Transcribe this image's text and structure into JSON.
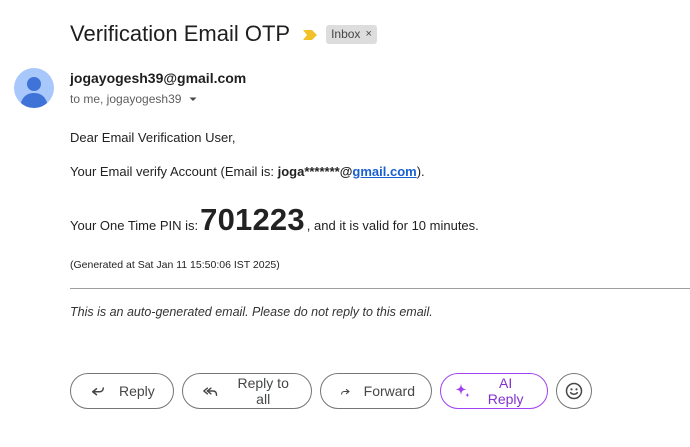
{
  "email": {
    "subject": "Verification Email OTP",
    "label": "Inbox",
    "label_remove": "×",
    "sender": "jogayogesh39@gmail.com",
    "recipients": "to me, jogayogesh39"
  },
  "message": {
    "greeting": "Dear Email Verification User,",
    "account_prefix": "Your Email verify Account (Email is: ",
    "account_masked_user": "joga*******",
    "account_at": "@",
    "account_domain": "gmail.com",
    "account_suffix": ").",
    "otp_prefix": "Your One Time PIN is: ",
    "otp_code": "701223",
    "otp_suffix": ", and it is valid for 10 minutes.",
    "generated_at": "(Generated at Sat Jan 11 15:50:06 IST 2025)",
    "footer": "This is an auto-generated email. Please do not reply to this email."
  },
  "actions": {
    "reply": "Reply",
    "reply_all": "Reply to all",
    "forward": "Forward",
    "ai_reply": "AI Reply"
  },
  "colors": {
    "accent_link": "#1a5fd0",
    "ai_purple": "#a142f4",
    "importance_yellow": "#f2c028",
    "avatar_bg": "#a8c7fa",
    "avatar_fg": "#3f73d8"
  }
}
